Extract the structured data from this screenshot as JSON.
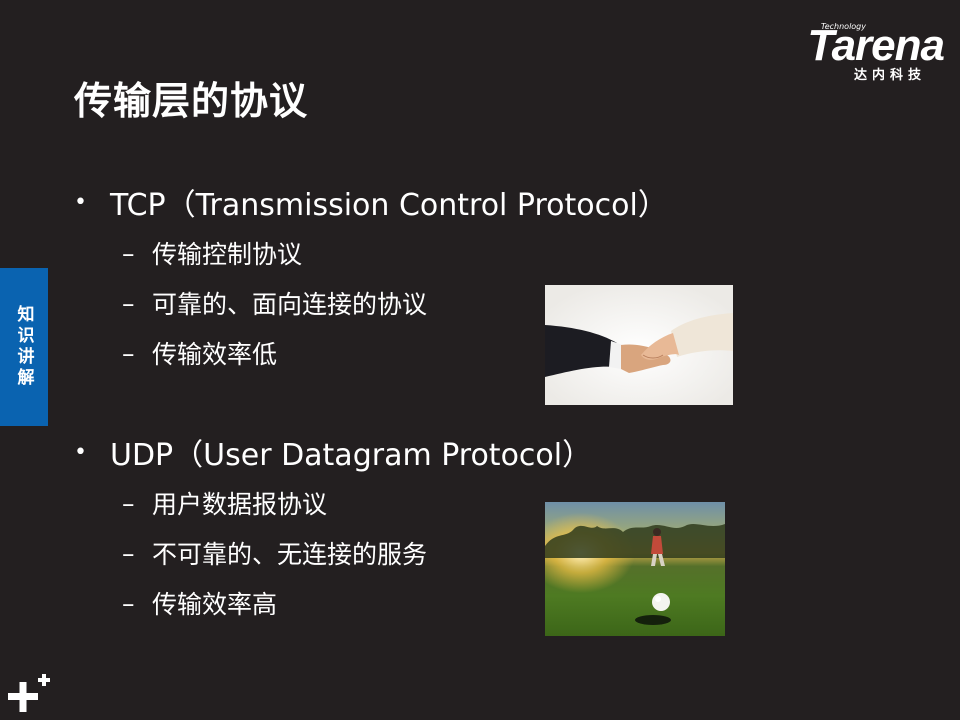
{
  "slide": {
    "title": "传输层的协议",
    "side_tab": "知识讲解"
  },
  "logo": {
    "tagline": "Technology",
    "brand": "Tarena",
    "cn": "达内科技"
  },
  "bullets": [
    {
      "text": "TCP（Transmission Control Protocol）",
      "subs": [
        "传输控制协议",
        "可靠的、面向连接的协议",
        "传输效率低"
      ]
    },
    {
      "text": "UDP（User Datagram Protocol）",
      "subs": [
        "用户数据报协议",
        "不可靠的、无连接的服务",
        "传输效率高"
      ]
    }
  ],
  "symbols": {
    "bullet": "•",
    "dash": "–"
  },
  "colors": {
    "background": "#231f20",
    "side_tab": "#0a63b0",
    "text": "#ffffff"
  },
  "icons": [
    "handshake-image",
    "golf-ball-image",
    "plus-mark-icon"
  ]
}
